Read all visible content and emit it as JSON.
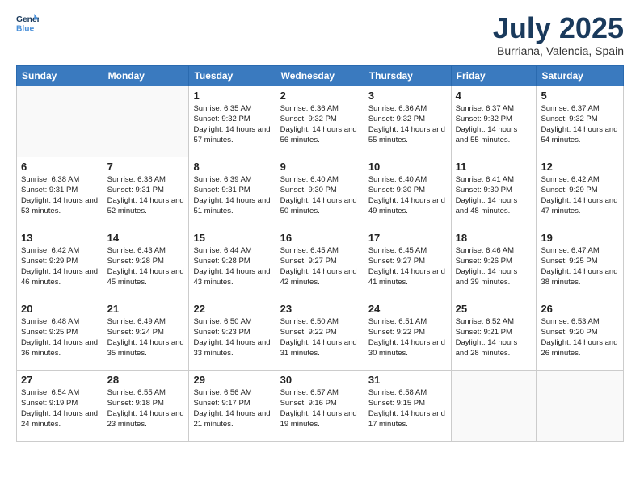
{
  "header": {
    "logo_line1": "General",
    "logo_line2": "Blue",
    "month": "July 2025",
    "location": "Burriana, Valencia, Spain"
  },
  "days_of_week": [
    "Sunday",
    "Monday",
    "Tuesday",
    "Wednesday",
    "Thursday",
    "Friday",
    "Saturday"
  ],
  "weeks": [
    [
      {
        "day": "",
        "sunrise": "",
        "sunset": "",
        "daylight": ""
      },
      {
        "day": "",
        "sunrise": "",
        "sunset": "",
        "daylight": ""
      },
      {
        "day": "1",
        "sunrise": "Sunrise: 6:35 AM",
        "sunset": "Sunset: 9:32 PM",
        "daylight": "Daylight: 14 hours and 57 minutes."
      },
      {
        "day": "2",
        "sunrise": "Sunrise: 6:36 AM",
        "sunset": "Sunset: 9:32 PM",
        "daylight": "Daylight: 14 hours and 56 minutes."
      },
      {
        "day": "3",
        "sunrise": "Sunrise: 6:36 AM",
        "sunset": "Sunset: 9:32 PM",
        "daylight": "Daylight: 14 hours and 55 minutes."
      },
      {
        "day": "4",
        "sunrise": "Sunrise: 6:37 AM",
        "sunset": "Sunset: 9:32 PM",
        "daylight": "Daylight: 14 hours and 55 minutes."
      },
      {
        "day": "5",
        "sunrise": "Sunrise: 6:37 AM",
        "sunset": "Sunset: 9:32 PM",
        "daylight": "Daylight: 14 hours and 54 minutes."
      }
    ],
    [
      {
        "day": "6",
        "sunrise": "Sunrise: 6:38 AM",
        "sunset": "Sunset: 9:31 PM",
        "daylight": "Daylight: 14 hours and 53 minutes."
      },
      {
        "day": "7",
        "sunrise": "Sunrise: 6:38 AM",
        "sunset": "Sunset: 9:31 PM",
        "daylight": "Daylight: 14 hours and 52 minutes."
      },
      {
        "day": "8",
        "sunrise": "Sunrise: 6:39 AM",
        "sunset": "Sunset: 9:31 PM",
        "daylight": "Daylight: 14 hours and 51 minutes."
      },
      {
        "day": "9",
        "sunrise": "Sunrise: 6:40 AM",
        "sunset": "Sunset: 9:30 PM",
        "daylight": "Daylight: 14 hours and 50 minutes."
      },
      {
        "day": "10",
        "sunrise": "Sunrise: 6:40 AM",
        "sunset": "Sunset: 9:30 PM",
        "daylight": "Daylight: 14 hours and 49 minutes."
      },
      {
        "day": "11",
        "sunrise": "Sunrise: 6:41 AM",
        "sunset": "Sunset: 9:30 PM",
        "daylight": "Daylight: 14 hours and 48 minutes."
      },
      {
        "day": "12",
        "sunrise": "Sunrise: 6:42 AM",
        "sunset": "Sunset: 9:29 PM",
        "daylight": "Daylight: 14 hours and 47 minutes."
      }
    ],
    [
      {
        "day": "13",
        "sunrise": "Sunrise: 6:42 AM",
        "sunset": "Sunset: 9:29 PM",
        "daylight": "Daylight: 14 hours and 46 minutes."
      },
      {
        "day": "14",
        "sunrise": "Sunrise: 6:43 AM",
        "sunset": "Sunset: 9:28 PM",
        "daylight": "Daylight: 14 hours and 45 minutes."
      },
      {
        "day": "15",
        "sunrise": "Sunrise: 6:44 AM",
        "sunset": "Sunset: 9:28 PM",
        "daylight": "Daylight: 14 hours and 43 minutes."
      },
      {
        "day": "16",
        "sunrise": "Sunrise: 6:45 AM",
        "sunset": "Sunset: 9:27 PM",
        "daylight": "Daylight: 14 hours and 42 minutes."
      },
      {
        "day": "17",
        "sunrise": "Sunrise: 6:45 AM",
        "sunset": "Sunset: 9:27 PM",
        "daylight": "Daylight: 14 hours and 41 minutes."
      },
      {
        "day": "18",
        "sunrise": "Sunrise: 6:46 AM",
        "sunset": "Sunset: 9:26 PM",
        "daylight": "Daylight: 14 hours and 39 minutes."
      },
      {
        "day": "19",
        "sunrise": "Sunrise: 6:47 AM",
        "sunset": "Sunset: 9:25 PM",
        "daylight": "Daylight: 14 hours and 38 minutes."
      }
    ],
    [
      {
        "day": "20",
        "sunrise": "Sunrise: 6:48 AM",
        "sunset": "Sunset: 9:25 PM",
        "daylight": "Daylight: 14 hours and 36 minutes."
      },
      {
        "day": "21",
        "sunrise": "Sunrise: 6:49 AM",
        "sunset": "Sunset: 9:24 PM",
        "daylight": "Daylight: 14 hours and 35 minutes."
      },
      {
        "day": "22",
        "sunrise": "Sunrise: 6:50 AM",
        "sunset": "Sunset: 9:23 PM",
        "daylight": "Daylight: 14 hours and 33 minutes."
      },
      {
        "day": "23",
        "sunrise": "Sunrise: 6:50 AM",
        "sunset": "Sunset: 9:22 PM",
        "daylight": "Daylight: 14 hours and 31 minutes."
      },
      {
        "day": "24",
        "sunrise": "Sunrise: 6:51 AM",
        "sunset": "Sunset: 9:22 PM",
        "daylight": "Daylight: 14 hours and 30 minutes."
      },
      {
        "day": "25",
        "sunrise": "Sunrise: 6:52 AM",
        "sunset": "Sunset: 9:21 PM",
        "daylight": "Daylight: 14 hours and 28 minutes."
      },
      {
        "day": "26",
        "sunrise": "Sunrise: 6:53 AM",
        "sunset": "Sunset: 9:20 PM",
        "daylight": "Daylight: 14 hours and 26 minutes."
      }
    ],
    [
      {
        "day": "27",
        "sunrise": "Sunrise: 6:54 AM",
        "sunset": "Sunset: 9:19 PM",
        "daylight": "Daylight: 14 hours and 24 minutes."
      },
      {
        "day": "28",
        "sunrise": "Sunrise: 6:55 AM",
        "sunset": "Sunset: 9:18 PM",
        "daylight": "Daylight: 14 hours and 23 minutes."
      },
      {
        "day": "29",
        "sunrise": "Sunrise: 6:56 AM",
        "sunset": "Sunset: 9:17 PM",
        "daylight": "Daylight: 14 hours and 21 minutes."
      },
      {
        "day": "30",
        "sunrise": "Sunrise: 6:57 AM",
        "sunset": "Sunset: 9:16 PM",
        "daylight": "Daylight: 14 hours and 19 minutes."
      },
      {
        "day": "31",
        "sunrise": "Sunrise: 6:58 AM",
        "sunset": "Sunset: 9:15 PM",
        "daylight": "Daylight: 14 hours and 17 minutes."
      },
      {
        "day": "",
        "sunrise": "",
        "sunset": "",
        "daylight": ""
      },
      {
        "day": "",
        "sunrise": "",
        "sunset": "",
        "daylight": ""
      }
    ]
  ]
}
